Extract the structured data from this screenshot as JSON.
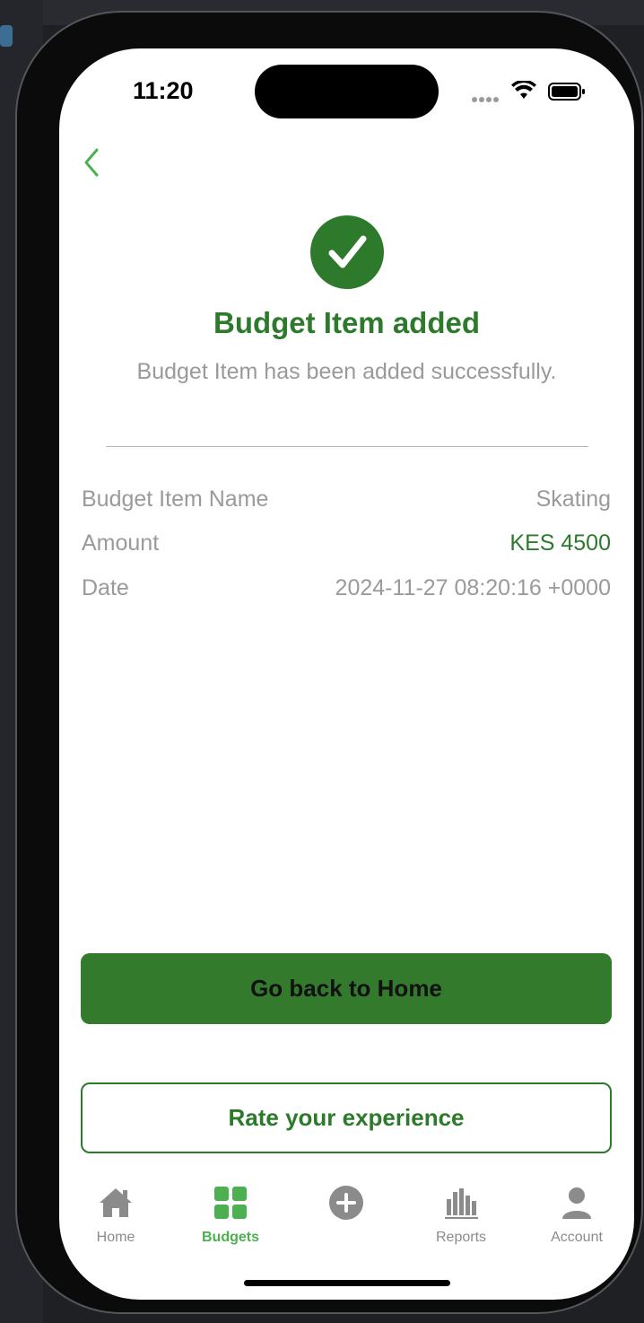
{
  "status": {
    "time": "11:20"
  },
  "success": {
    "title": "Budget Item added",
    "message": "Budget Item has been added successfully."
  },
  "details": [
    {
      "label": "Budget Item Name",
      "value": "Skating"
    },
    {
      "label": "Amount",
      "value": "KES 4500"
    },
    {
      "label": "Date",
      "value": "2024-11-27 08:20:16 +0000"
    }
  ],
  "actions": {
    "primary": "Go back to Home",
    "secondary": "Rate your experience"
  },
  "tabs": [
    {
      "label": "Home",
      "icon": "house-icon"
    },
    {
      "label": "Budgets",
      "icon": "grid-icon",
      "active": true
    },
    {
      "label": "",
      "icon": "plus-circle-icon"
    },
    {
      "label": "Reports",
      "icon": "bar-chart-icon"
    },
    {
      "label": "Account",
      "icon": "person-icon"
    }
  ],
  "colors": {
    "accent": "#2e7a2c",
    "active_tab": "#4caf50",
    "muted": "#9a9a9a"
  }
}
